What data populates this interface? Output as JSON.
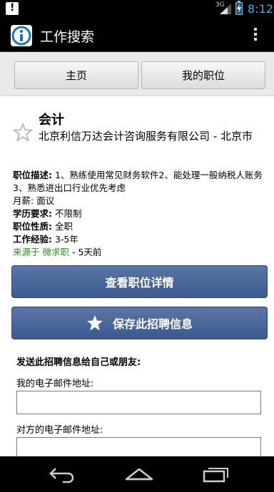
{
  "status_bar": {
    "network": "3G",
    "time": "8:12"
  },
  "app_bar": {
    "title": "工作搜索"
  },
  "tabs": {
    "home": "主页",
    "my_jobs": "我的职位"
  },
  "job": {
    "title": "会计",
    "company_location": "北京利信万达会计咨询服务有限公司 - 北京市",
    "description_label": "职位描述:",
    "description": " 1、熟练使用常见财务软件2、能处理一般纳税人账务3、熟悉进出口行业优先考虑",
    "salary_label": "月薪:",
    "salary": " 面议",
    "education_label": "学历要求:",
    "education": " 不限制",
    "type_label": "职位性质:",
    "type": " 全职",
    "experience_label": "工作经验:",
    "experience": " 3-5年",
    "source": "来源于 微求职",
    "posted": " - 5天前"
  },
  "actions": {
    "view_details": "查看职位详情",
    "save": "保存此招聘信息"
  },
  "share": {
    "heading": "发送此招聘信息给自己或朋友:",
    "my_email_label": "我的电子邮件地址:",
    "my_email_value": "",
    "other_email_label": "对方的电子邮件地址:",
    "other_email_value": ""
  },
  "colors": {
    "accent_blue": "#33b5e5",
    "button_blue": "#4a6899",
    "source_green": "#2d8f22"
  },
  "icons": {
    "notification": "notification-alert-icon",
    "signal": "signal-icon",
    "battery": "battery-charging-icon",
    "app_logo": "info-logo-icon",
    "overflow": "overflow-menu-icon",
    "favorite": "star-outline-icon",
    "save": "star-filled-icon",
    "back": "back-icon",
    "home": "home-icon",
    "recents": "recents-icon"
  }
}
